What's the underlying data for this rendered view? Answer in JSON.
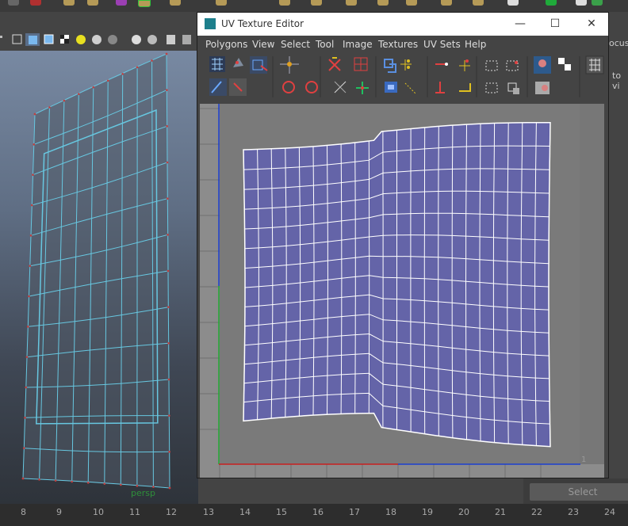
{
  "window": {
    "title": "UV Texture Editor",
    "minimize_glyph": "—",
    "maximize_glyph": "☐",
    "close_glyph": "✕"
  },
  "menu": [
    "Polygons",
    "View",
    "Select",
    "Tool",
    "Image",
    "Textures",
    "UV Sets",
    "Help"
  ],
  "viewport": {
    "camera_label": "persp"
  },
  "right_panel": {
    "text1": "ocus",
    "text2": "to vi"
  },
  "channel_box": {
    "select_label": "Select"
  },
  "timeline": {
    "ticks": [
      "8",
      "9",
      "10",
      "11",
      "12",
      "13",
      "14",
      "15",
      "16",
      "17",
      "18",
      "19",
      "20",
      "21",
      "22",
      "23",
      "24"
    ]
  },
  "uv_editor": {
    "corner_label": "1"
  },
  "colors": {
    "uv_fill": "#6464a8",
    "uv_edges": "#ffffff",
    "wire": "#67c7e0",
    "u_axis": "#c82020",
    "v_axis": "#1c3fd0",
    "green_axis": "#22aa33"
  },
  "icons": {
    "uv_toolbar_row1": [
      "uv-select-icon",
      "uv-move-icon",
      "uv-lattice-icon",
      "uv-flip-icon",
      "uv-rotate-icon",
      "uv-cut-icon",
      "uv-sew-icon",
      "uv-merge-icon",
      "uv-split-icon",
      "uv-layout-icon",
      "uv-grid-icon",
      "uv-image-icon",
      "uv-checker-icon",
      "uv-grid-display-icon"
    ],
    "uv_toolbar_row2": [
      "uv-smudge-icon",
      "uv-shell-icon",
      "uv-rotate-ccw-icon",
      "uv-rotate-cw-icon",
      "uv-straighten-icon",
      "uv-align-icon",
      "uv-unfold-icon",
      "uv-snap-icon",
      "uv-normalize-icon",
      "uv-map-icon",
      "uv-isolate-icon",
      "uv-filter-icon",
      "uv-dim-image-icon"
    ]
  }
}
